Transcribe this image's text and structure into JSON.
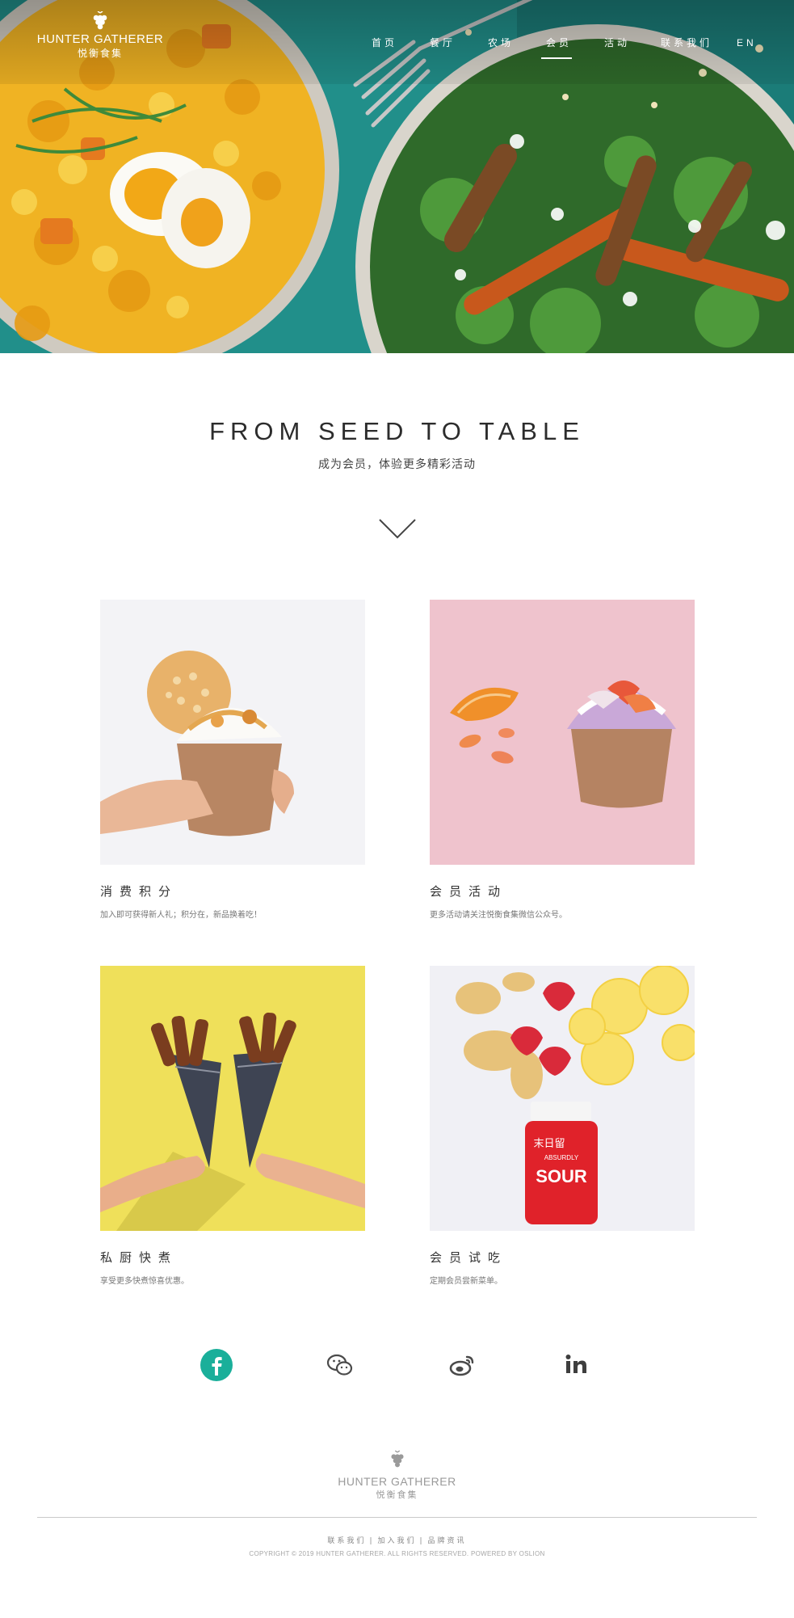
{
  "brand": {
    "name_en": "HUNTER GATHERER",
    "name_cn": "悦衡食集"
  },
  "nav": {
    "items": [
      {
        "label": "首页"
      },
      {
        "label": "餐厅"
      },
      {
        "label": "农场"
      },
      {
        "label": "会员",
        "active": true
      },
      {
        "label": "活动"
      },
      {
        "label": "联系我们"
      }
    ],
    "lang": "EN"
  },
  "hero": {
    "headline": "FROM SEED TO TABLE",
    "subhead": "成为会员，体验更多精彩活动"
  },
  "cards": [
    {
      "title": "消费积分",
      "desc": "加入即可获得新人礼；积分在，新品换着吃！"
    },
    {
      "title": "会员活动",
      "desc": "更多活动请关注悦衡食集微信公众号。"
    },
    {
      "title": "私厨快煮",
      "desc": "享受更多快煮惊喜优惠。"
    },
    {
      "title": "会员试吃",
      "desc": "定期会员尝新菜单。"
    }
  ],
  "product_label": {
    "cn": "末日留",
    "en": "ABSURDLY",
    "big": "SOUR"
  },
  "social": [
    "facebook-icon",
    "wechat-icon",
    "weibo-icon",
    "linkedin-icon"
  ],
  "colors": {
    "accent": "#1aaf9a",
    "hero_bg": "#1f8f8b",
    "card_pink": "#f2c6cf",
    "card_yellow": "#f0e35a"
  },
  "footer": {
    "links": [
      "联系我们",
      "加入我们",
      "品牌资讯"
    ],
    "copyright": "COPYRIGHT © 2019 HUNTER GATHERER. ALL RIGHTS RESERVED. POWERED BY OSLION"
  }
}
